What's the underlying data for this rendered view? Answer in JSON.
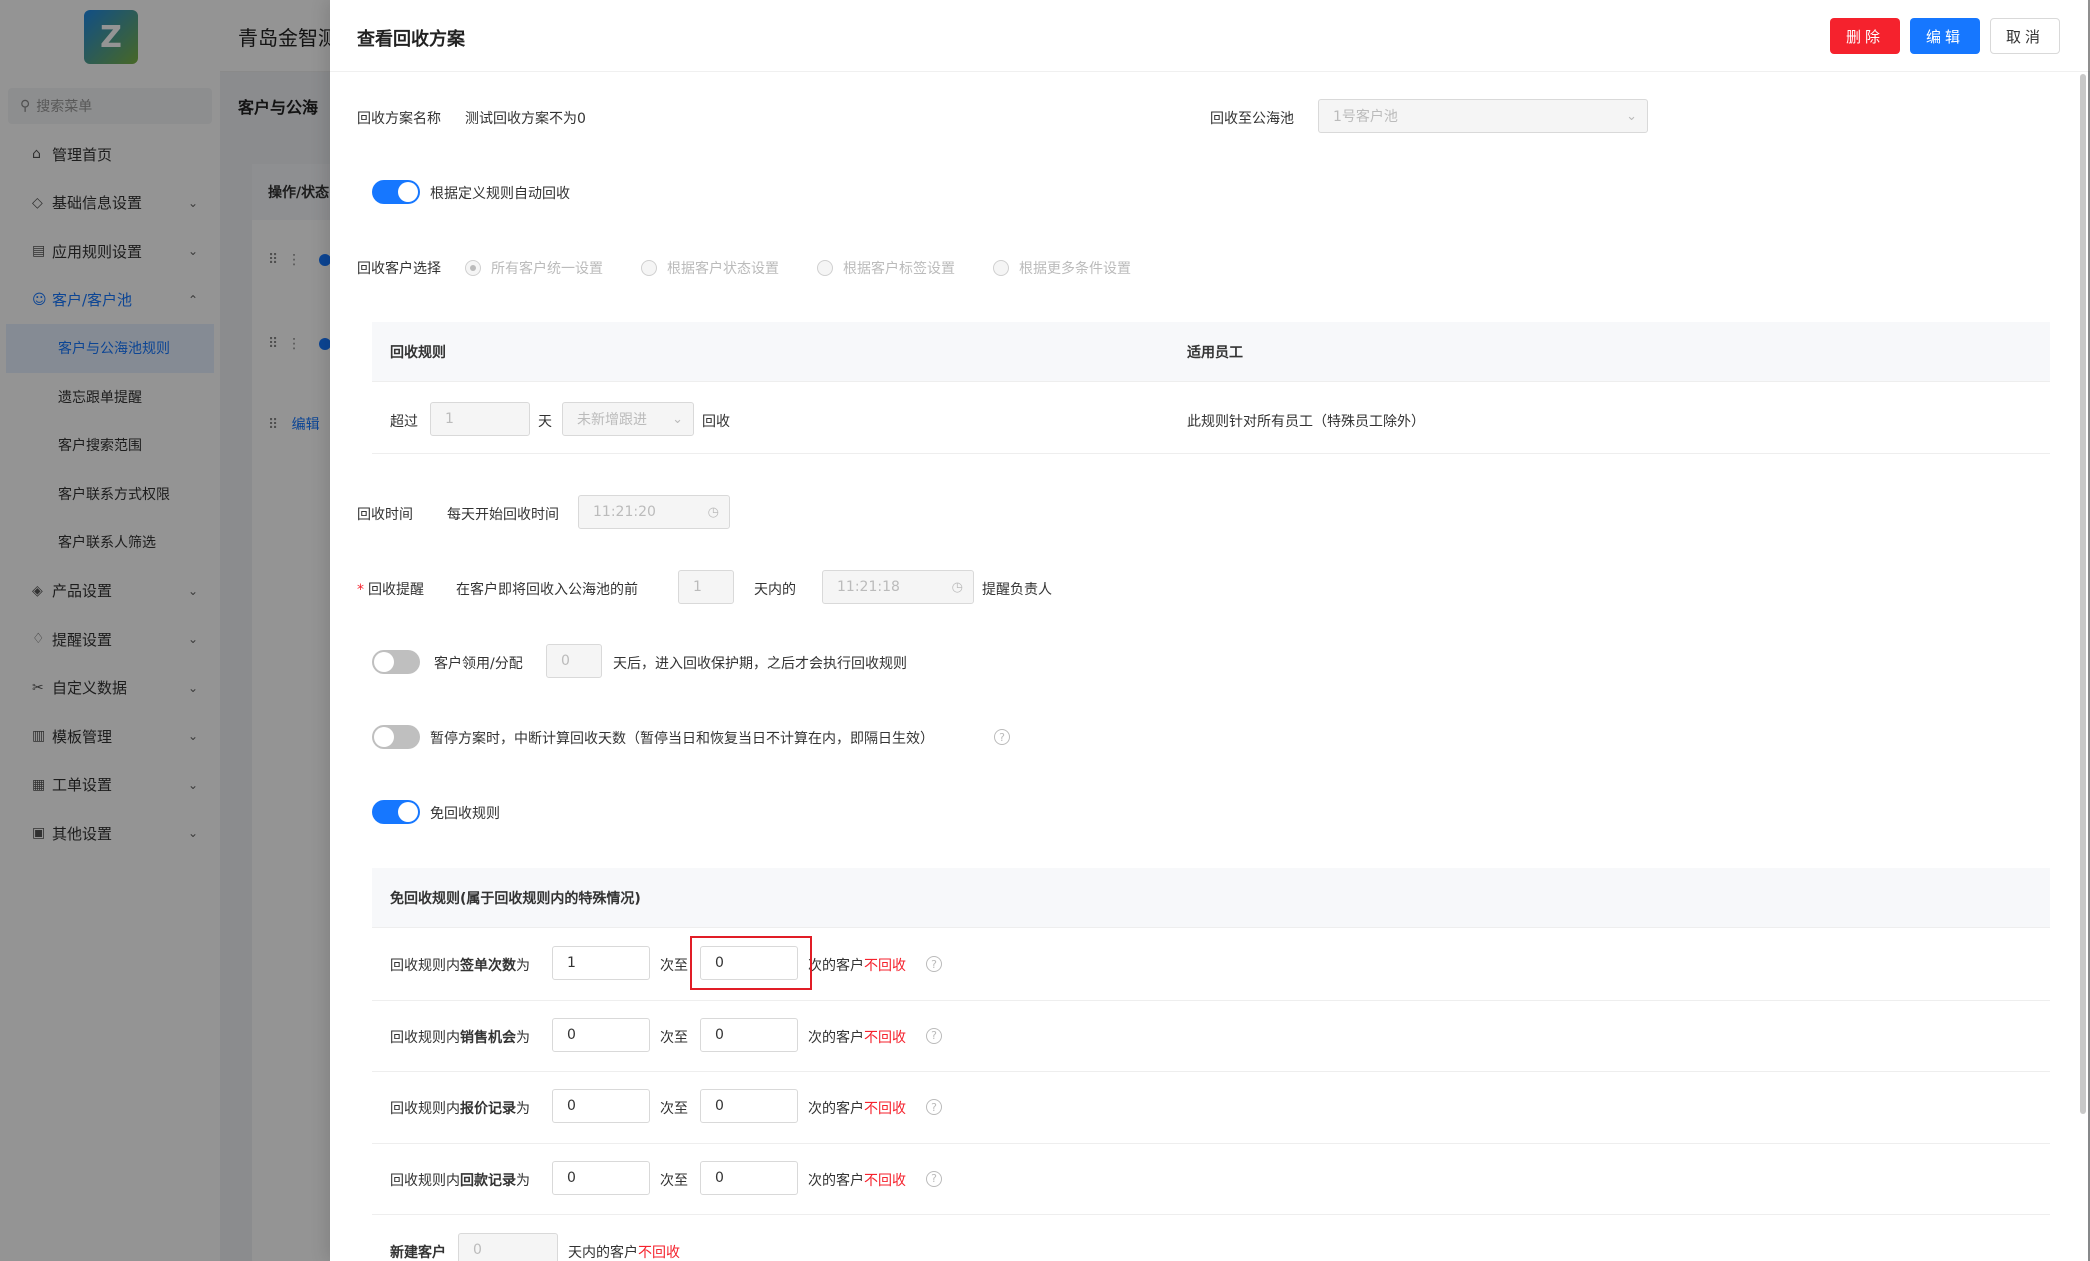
{
  "app": {
    "brand": "青岛金智测",
    "breadcrumb": "客户与公海",
    "search_placeholder": "搜索菜单",
    "logo_text": "Z"
  },
  "sidebar": {
    "items": [
      {
        "label": "管理首页",
        "icon": "home-icon",
        "glyph": "⌂",
        "arrow": ""
      },
      {
        "label": "基础信息设置",
        "icon": "cube-icon",
        "glyph": "◇",
        "arrow": "⌄"
      },
      {
        "label": "应用规则设置",
        "icon": "document-icon",
        "glyph": "▤",
        "arrow": "⌄"
      },
      {
        "label": "客户/客户池",
        "icon": "users-icon",
        "glyph": "☺",
        "arrow": "⌃",
        "active": true
      },
      {
        "label": "客户与公海池规则",
        "sub": true,
        "selected": true
      },
      {
        "label": "遗忘跟单提醒",
        "sub": true
      },
      {
        "label": "客户搜索范围",
        "sub": true
      },
      {
        "label": "客户联系方式权限",
        "sub": true
      },
      {
        "label": "客户联系人筛选",
        "sub": true
      },
      {
        "label": "产品设置",
        "icon": "box-icon",
        "glyph": "◈",
        "arrow": "⌄"
      },
      {
        "label": "提醒设置",
        "icon": "bell-icon",
        "glyph": "♢",
        "arrow": "⌄"
      },
      {
        "label": "自定义数据",
        "icon": "custom-data-icon",
        "glyph": "✂",
        "arrow": "⌄"
      },
      {
        "label": "模板管理",
        "icon": "template-icon",
        "glyph": "▥",
        "arrow": "⌄"
      },
      {
        "label": "工单设置",
        "icon": "ticket-icon",
        "glyph": "▦",
        "arrow": "⌄"
      },
      {
        "label": "其他设置",
        "icon": "grid-icon",
        "glyph": "▣",
        "arrow": "⌄"
      }
    ]
  },
  "background": {
    "table_header": "操作/状态",
    "row_link": "编辑"
  },
  "drawer": {
    "title": "查看回收方案",
    "buttons": {
      "delete": "删除",
      "edit": "编辑",
      "cancel": "取消"
    },
    "plan_name_label": "回收方案名称",
    "plan_name_value": "测试回收方案不为0",
    "pool_label": "回收至公海池",
    "pool_value": "1号客户池",
    "auto_recycle_label": "根据定义规则自动回收",
    "customer_select_label": "回收客户选择",
    "customer_select_options": [
      "所有客户统一设置",
      "根据客户状态设置",
      "根据客户标签设置",
      "根据更多条件设置"
    ],
    "rule_table": {
      "col_rule": "回收规则",
      "col_staff": "适用员工",
      "exceed": "超过",
      "days_value": "1",
      "day_unit": "天",
      "condition_value": "未新增跟进",
      "recycle": "回收",
      "staff_value": "此规则针对所有员工（特殊员工除外）"
    },
    "recycle_time": {
      "label": "回收时间",
      "daily_label": "每天开始回收时间",
      "time_value": "11:21:20"
    },
    "reminder": {
      "label": "回收提醒",
      "prefix": "在客户即将回收入公海池的前",
      "days_value": "1",
      "days_suffix": "天内的",
      "time_value": "11:21:18",
      "suffix": "提醒负责人"
    },
    "protection": {
      "label": "客户领用/分配",
      "value": "0",
      "suffix": "天后，进入回收保护期，之后才会执行回收规则"
    },
    "pause_label": "暂停方案时，中断计算回收天数（暂停当日和恢复当日不计算在内，即隔日生效）",
    "exempt_label": "免回收规则",
    "exempt_table": {
      "header": "免回收规则(属于回收规则内的特殊情况)",
      "prefix": "回收规则内",
      "is_text": "为",
      "to_text": "次至",
      "customer_text": "次的客户",
      "not_recycle": "不回收",
      "rows": [
        {
          "field": "签单次数",
          "from": "1",
          "to": "0"
        },
        {
          "field": "销售机会",
          "from": "0",
          "to": "0"
        },
        {
          "field": "报价记录",
          "from": "0",
          "to": "0"
        },
        {
          "field": "回款记录",
          "from": "0",
          "to": "0"
        }
      ],
      "new_customer_label": "新建客户",
      "new_customer_value": "0",
      "new_customer_suffix": "天内的客户"
    }
  }
}
